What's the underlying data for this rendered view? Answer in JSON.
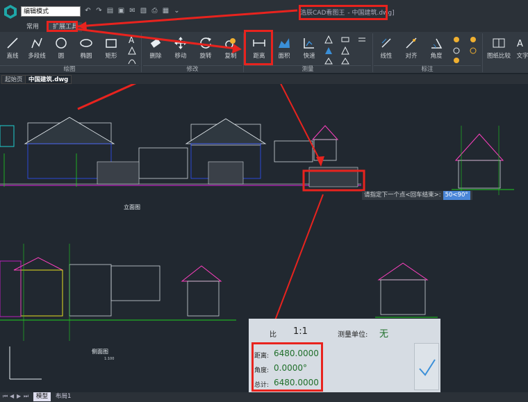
{
  "toolbar": {
    "mode_label": "编辑模式",
    "app_title": "浩辰CAD看图王",
    "file_title": "- 中国建筑.dwg]"
  },
  "ribbon_tabs": [
    "常用",
    "扩展工具"
  ],
  "ribbon_groups": {
    "draw": {
      "title": "绘图",
      "tools": [
        "直线",
        "多段线",
        "圆",
        "椭圆",
        "矩形"
      ]
    },
    "modify": {
      "title": "修改",
      "tools": [
        "删除",
        "移动",
        "旋转",
        "复制"
      ]
    },
    "measure": {
      "title": "测量",
      "tools": [
        "距离",
        "面积",
        "快速"
      ]
    },
    "annotate": {
      "title": "标注",
      "tools": [
        "线性",
        "对齐",
        "角度"
      ]
    },
    "extra": {
      "tools": [
        "图纸比较",
        "文字"
      ]
    }
  },
  "doc_tabs": [
    "起始页",
    "中国建筑.dwg"
  ],
  "drawing_labels": {
    "front_elevation": "立面图",
    "side_elevation": "侧面图",
    "scale_small": "1:100"
  },
  "command_prompt": {
    "text": "请指定下一个点<回车结束>:",
    "input": "50<90°"
  },
  "measure_panel": {
    "ratio_label": "比",
    "ratio_value": "1:1",
    "unit_label": "测量单位:",
    "unit_value": "无",
    "distance_label": "距离:",
    "distance_value": "6480.0000",
    "angle_label": "角度:",
    "angle_value": "0.0000°",
    "total_label": "总计:",
    "total_value": "6480.0000"
  },
  "layout_tabs": [
    "模型",
    "布局1"
  ],
  "colors": {
    "highlight": "#e8231e",
    "canvas_bg": "#212830",
    "command_input": "#4a86d8",
    "panel_bg": "#d6dce3",
    "value_green": "#1f6f2a"
  }
}
